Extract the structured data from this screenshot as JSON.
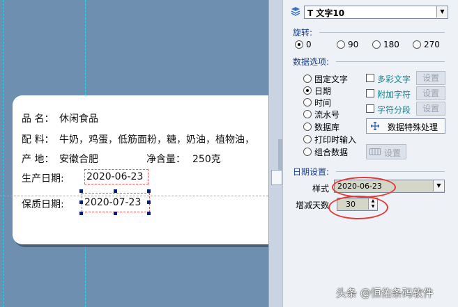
{
  "label": {
    "line1_label": "品 名：",
    "line1_value": "休闲食品",
    "line2_label": "配 料：",
    "line2_value": "牛奶，鸡蛋，低筋面粉，糖，奶油，植物油，",
    "line3_label": "产 地：",
    "line3_value": "安徽合肥",
    "net_label": "净含量：",
    "net_value": "250克",
    "prod_date_label": "生产日期:",
    "prod_date_value": "2020-06-23",
    "expiry_label": "保质日期:",
    "expiry_value": "2020-07-23"
  },
  "panel": {
    "object_select": "T 文字10",
    "rotation_title": "旋转:",
    "rotation_options": [
      "0",
      "90",
      "180",
      "270"
    ],
    "rotation_selected": "0",
    "data_title": "数据选项:",
    "data_options": [
      "固定文字",
      "日期",
      "时间",
      "流水号",
      "数据库",
      "打印时输入",
      "组合数据"
    ],
    "data_selected": "日期",
    "checks": [
      "多彩文字",
      "附加字符",
      "字符分段"
    ],
    "setting_label": "设置",
    "special_button": "数据特殊处理",
    "combo_setting_label": "设置",
    "date_title": "日期设置:",
    "style_label": "样式",
    "style_value": "2020-06-23",
    "days_label": "增减天数",
    "days_value": "30"
  },
  "watermark": "头条 @恒佑条码软件",
  "colors": {
    "canvas_bg": "#6f8fb1",
    "guide": "#1fd6ee",
    "highlight_oval": "#e23a3a"
  }
}
